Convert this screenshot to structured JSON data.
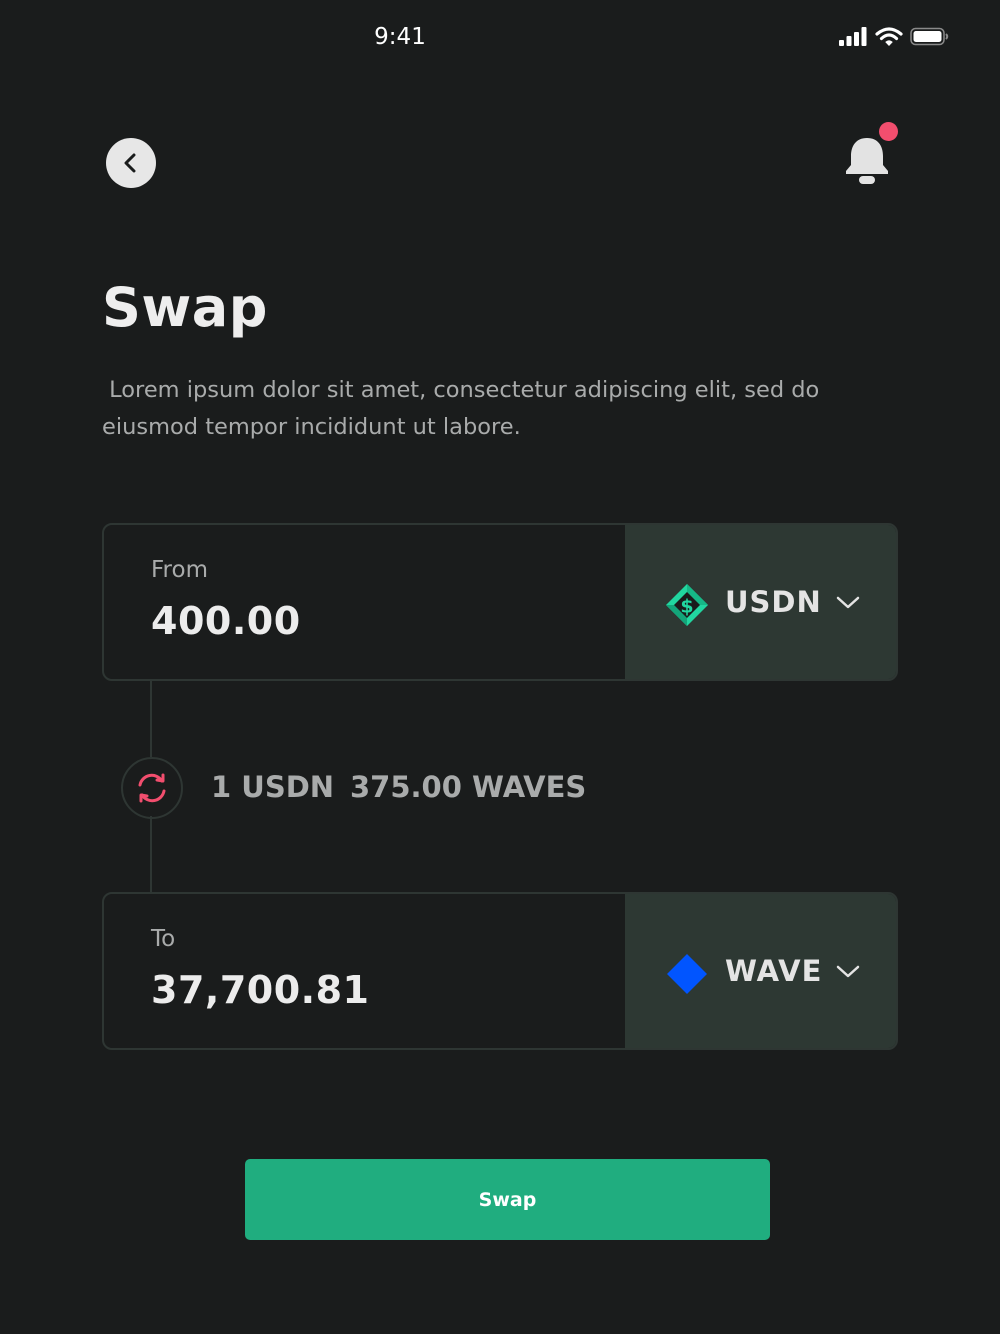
{
  "status_bar": {
    "time": "9:41",
    "icons": [
      "cellular-signal-icon",
      "wifi-icon",
      "battery-icon"
    ]
  },
  "header": {
    "back_icon": "chevron-left-icon",
    "notification_icon": "bell-icon",
    "has_notification": true
  },
  "page": {
    "title": "Swap",
    "subtitle": " Lorem ipsum dolor sit amet, consectetur adipiscing elit, sed do\neiusmod tempor incididunt ut labore."
  },
  "from": {
    "label": "From",
    "amount": "400.00",
    "token": "USDN",
    "token_icon": "usdn-dollar-diamond-icon"
  },
  "to": {
    "label": "To",
    "amount": "37,700.81",
    "token": "WAVE",
    "token_icon": "waves-diamond-icon"
  },
  "rate": {
    "from_text": "1 USDN",
    "to_text": "375.00 WAVES",
    "icon": "refresh-swap-icon"
  },
  "actions": {
    "swap_label": "Swap"
  },
  "colors": {
    "background": "#1a1c1c",
    "card_border": "#2e3633",
    "token_panel": "#2d3833",
    "accent_green": "#20ad7f",
    "usdn_green": "#21d6a0",
    "waves_blue": "#0155ff",
    "notification_red": "#f24e6e",
    "muted_text": "#a9abab"
  }
}
